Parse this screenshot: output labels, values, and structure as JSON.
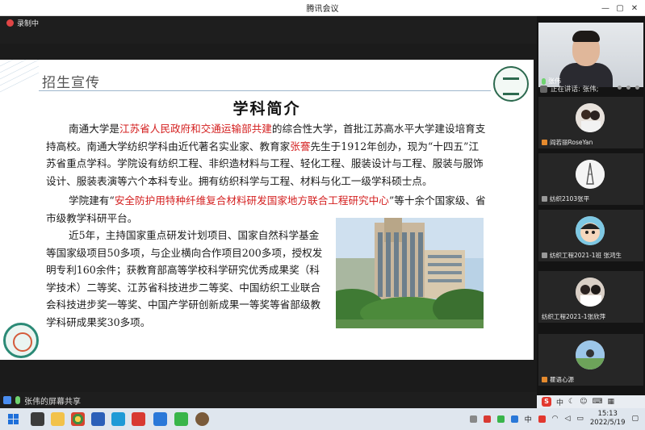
{
  "window": {
    "title": "腾讯会议",
    "controls": [
      "—",
      "▢",
      "✕"
    ]
  },
  "recording": {
    "label": "录制中"
  },
  "slide": {
    "header": "招生宣传",
    "title": "学科简介",
    "p1_a": "南通大学是",
    "p1_red1": "江苏省人民政府和交通运输部共建",
    "p1_b": "的综合性大学，首批江苏高水平大学建设培育支持高校。南通大学纺织学科由近代著名实业家、教育家",
    "p1_red2": "张謇",
    "p1_c": "先生于1912年创办，现为“十四五”江苏省重点学科。学院设有纺织工程、非织造材料与工程、轻化工程、服装设计与工程、服装与服饰设计、服装表演等六个本科专业。拥有纺织科学与工程、材料与化工一级学科硕士点。",
    "p2_a": "学院建有“",
    "p2_red": "安全防护用特种纤维复合材料研发国家地方联合工程研究中心",
    "p2_b": "”等十余个国家级、省市级教学科研平台。",
    "p3": "近5年，主持国家重点研发计划项目、国家自然科学基金等国家级项目50多项，与企业横向合作项目200多项，授权发明专利160余件；获教育部高等学校科学研究优秀成果奖（科学技术）二等奖、江苏省科技进步二等奖、中国纺织工业联合会科技进步奖一等奖、中国产学研创新成果一等奖等省部级教学科研成果奖30多项。"
  },
  "share_bar": {
    "label": "张伟的屏幕共享"
  },
  "panel": {
    "main_cam_name": "张伟",
    "speaking": "正在讲话: 张伟;",
    "participants": [
      {
        "name": "阎若丽RoseYan"
      },
      {
        "name": "纺织2103张平"
      },
      {
        "name": "纺织工程2021-1班 张鸿生"
      },
      {
        "name": "纺织工程2021-1张欣萍"
      },
      {
        "name": "瞿语心源"
      }
    ],
    "ime": "中"
  },
  "taskbar": {
    "ime": "中",
    "time": "15:13",
    "date": "2022/5/19"
  },
  "colors": {
    "accent_red": "#d42020",
    "taskbar": "#dfe6ee",
    "panel_bg": "#141414"
  }
}
